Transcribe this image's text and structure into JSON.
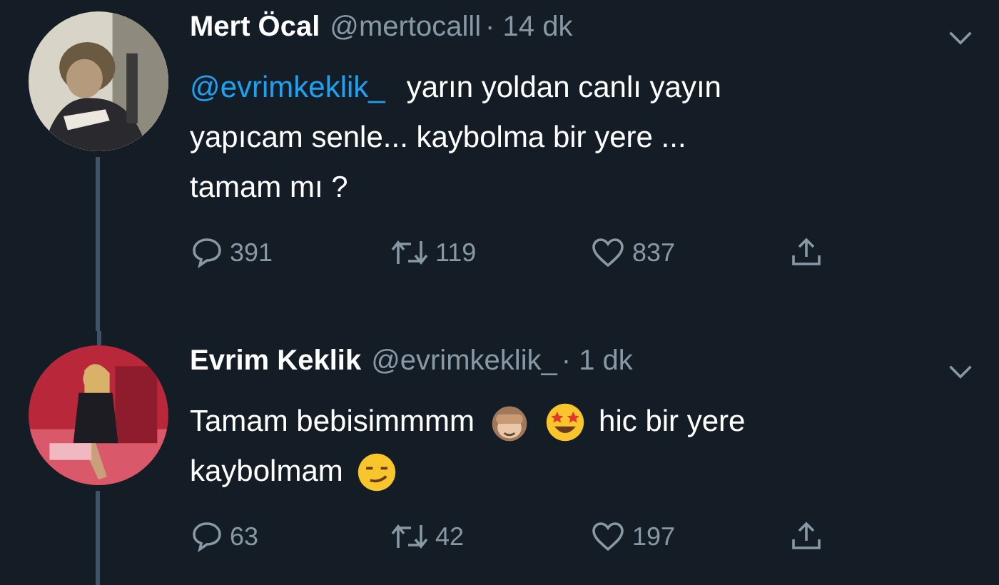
{
  "tweets": [
    {
      "name": "Mert Öcal",
      "handle": "@mertocalll",
      "time": "· 14 dk",
      "thread": true,
      "body_lines": [
        [
          {
            "kind": "mention",
            "text": "@evrimkeklik_"
          },
          {
            "kind": "text",
            "text": "yarın yoldan canlı yayın"
          }
        ],
        [
          {
            "kind": "text",
            "text": "yapıcam senle... kaybolma bir yere ..."
          }
        ],
        [
          {
            "kind": "text",
            "text": "tamam mı ?"
          }
        ]
      ],
      "replies": "391",
      "retweets": "119",
      "likes": "837"
    },
    {
      "name": "Evrim Keklik",
      "handle": "@evrimkeklik_",
      "time": "· 1 dk",
      "thread": true,
      "body_lines": [
        [
          {
            "kind": "text",
            "text": "Tamam bebisimmmm"
          },
          {
            "kind": "emoji"
          },
          {
            "kind": "emoji"
          },
          {
            "kind": "text",
            "text": "hic bir yere"
          }
        ],
        [
          {
            "kind": "text",
            "text": "kaybolmam"
          },
          {
            "kind": "emoji"
          }
        ]
      ],
      "replies": "63",
      "retweets": "42",
      "likes": "197"
    }
  ]
}
